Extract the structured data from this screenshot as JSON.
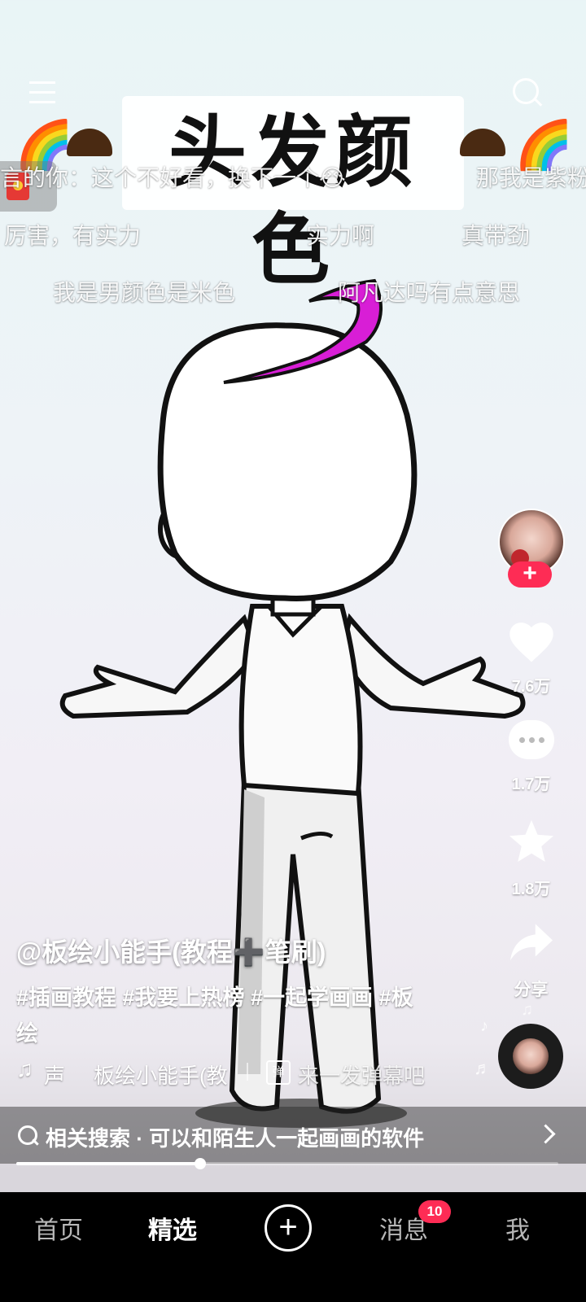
{
  "title_overlay": "头发颜色",
  "danmaku": [
    "言的你：这个不好看，换下一个😭",
    "那我是紫粉",
    "厉害，有实力",
    "实力啊",
    "真带劲",
    "我是男颜色是米色",
    "阿凡达吗有点意思"
  ],
  "rainbow_emojis": [
    "🌈",
    "🌈"
  ],
  "author": "@板绘小能手(教程➕笔刷)",
  "hashtags_line1": "#插画教程 #我要上热榜 #一起学画画 #板",
  "hashtags_line2": "绘",
  "sound_label": "声",
  "music_name": "板绘小能手(教",
  "danmaku_prompt": "来一发弹幕吧",
  "danmaku_icon_text": "弹",
  "likes": "7.6万",
  "comments": "1.7万",
  "favorites": "1.8万",
  "share_label": "分享",
  "related_search": "相关搜索 · 可以和陌生人一起画画的软件",
  "progress": 0.34,
  "nav": {
    "home": "首页",
    "featured": "精选",
    "messages": "消息",
    "messages_badge": "10",
    "me": "我"
  },
  "colors": {
    "badge": "#fe2c55",
    "hair": "#d81ed6"
  }
}
